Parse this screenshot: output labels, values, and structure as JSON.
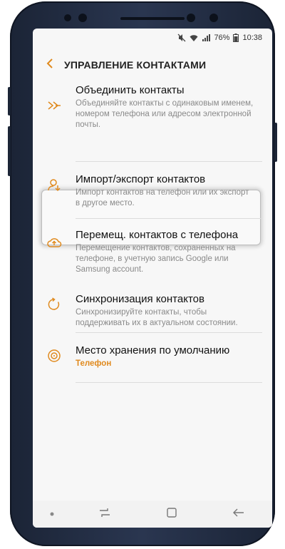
{
  "status_bar": {
    "battery": "76%",
    "time": "10:38",
    "icons": [
      "mute-icon",
      "wifi-icon",
      "signal-icon",
      "battery-icon"
    ]
  },
  "header": {
    "back_icon": "chevron-left-icon",
    "title": "УПРАВЛЕНИЕ КОНТАКТАМИ"
  },
  "colors": {
    "accent": "#e08a1e",
    "background": "#f7f7f7",
    "text": "#111111",
    "secondary_text": "#8a8a8a"
  },
  "items": [
    {
      "icon": "merge-icon",
      "title": "Объединить контакты",
      "subtitle": "Объединяйте контакты с одинаковым именем, номером телефона или адресом электронной почты."
    },
    {
      "icon": "import-export-icon",
      "title": "Импорт/экспорт контактов",
      "subtitle": "Импорт контактов на телефон или их экспорт в другое место."
    },
    {
      "icon": "cloud-upload-icon",
      "title": "Перемещ. контактов с телефона",
      "subtitle": "Перемещение контактов, сохраненных на телефоне, в учетную запись Google или Samsung account."
    },
    {
      "icon": "sync-icon",
      "title": "Синхронизация контактов",
      "subtitle": "Синхронизируйте контакты, чтобы поддерживать их в актуальном состоянии."
    },
    {
      "icon": "storage-icon",
      "title": "Место хранения по умолчанию",
      "subtitle": "Телефон"
    }
  ],
  "nav_bar": [
    "recents-icon",
    "home-icon",
    "back-icon"
  ]
}
